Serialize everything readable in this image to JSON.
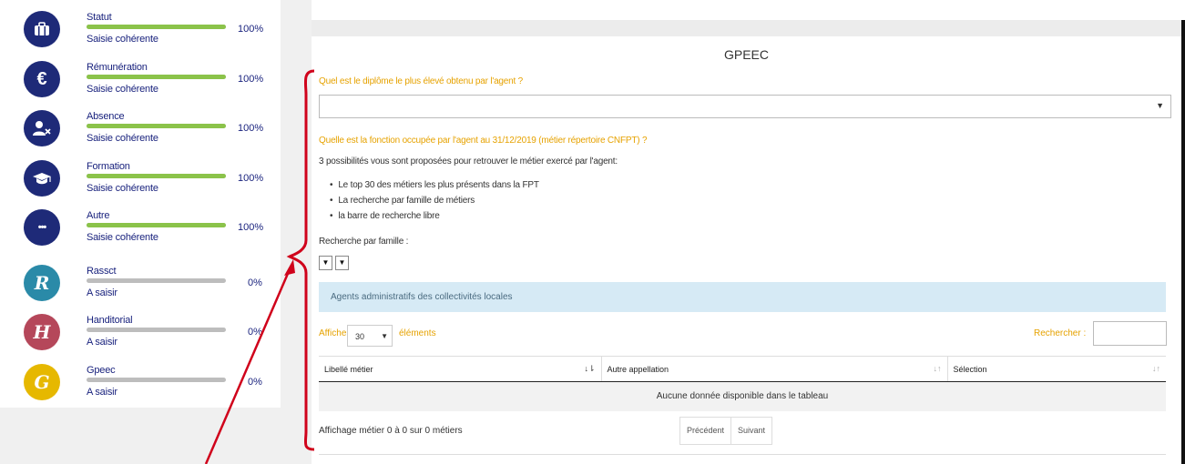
{
  "sidebar": {
    "items": [
      {
        "name": "Statut",
        "status": "Saisie cohérente",
        "percent": "100%",
        "progress": 1.0,
        "color": "#1e2a78",
        "icon": "briefcase-icon"
      },
      {
        "name": "Rémunération",
        "status": "Saisie cohérente",
        "percent": "100%",
        "progress": 1.0,
        "color": "#1e2a78",
        "icon": "euro-icon",
        "glyph": "€"
      },
      {
        "name": "Absence",
        "status": "Saisie cohérente",
        "percent": "100%",
        "progress": 1.0,
        "color": "#1e2a78",
        "icon": "user-remove-icon"
      },
      {
        "name": "Formation",
        "status": "Saisie cohérente",
        "percent": "100%",
        "progress": 1.0,
        "color": "#1e2a78",
        "icon": "graduation-cap-icon"
      },
      {
        "name": "Autre",
        "status": "Saisie cohérente",
        "percent": "100%",
        "progress": 1.0,
        "color": "#1e2a78",
        "icon": "more-dots-icon",
        "glyph": "•••"
      },
      {
        "name": "Rassct",
        "status": "A saisir",
        "percent": "0%",
        "progress": 0.0,
        "color": "#2a8aa8",
        "icon": "letter-r-icon",
        "glyph": "R"
      },
      {
        "name": "Handitorial",
        "status": "A saisir",
        "percent": "0%",
        "progress": 0.0,
        "color": "#b5475a",
        "icon": "letter-h-icon",
        "glyph": "H"
      },
      {
        "name": "Gpeec",
        "status": "A saisir",
        "percent": "0%",
        "progress": 0.0,
        "color": "#e6b800",
        "icon": "letter-g-icon",
        "glyph": "G"
      }
    ]
  },
  "main": {
    "title": "GPEEC",
    "question_diploma": "Quel est le diplôme le plus élevé obtenu par l'agent ?",
    "question_function": "Quelle est la fonction occupée par l'agent au 31/12/2019 (métier répertoire CNFPT) ?",
    "intro": "3 possibilités vous sont proposées pour retrouver le métier exercé par l'agent:",
    "options": [
      "Le top 30 des métiers les plus présents dans la FPT",
      "La recherche par famille de métiers",
      "la barre de recherche libre"
    ],
    "family_label": "Recherche par famille :",
    "banner": "Agents administratifs des collectivités locales",
    "show_prefix": "Afficher",
    "show_count": "30",
    "show_suffix": "éléments",
    "search_label": "Rechercher :",
    "columns": [
      "Libellé métier",
      "Autre appellation",
      "Sélection"
    ],
    "empty": "Aucune donnée disponible dans le tableau",
    "info": "Affichage métier 0 à 0 sur 0 métiers",
    "prev": "Précédent",
    "next": "Suivant",
    "accent_color": "#e6a200",
    "annotation_color": "#d0021b"
  }
}
